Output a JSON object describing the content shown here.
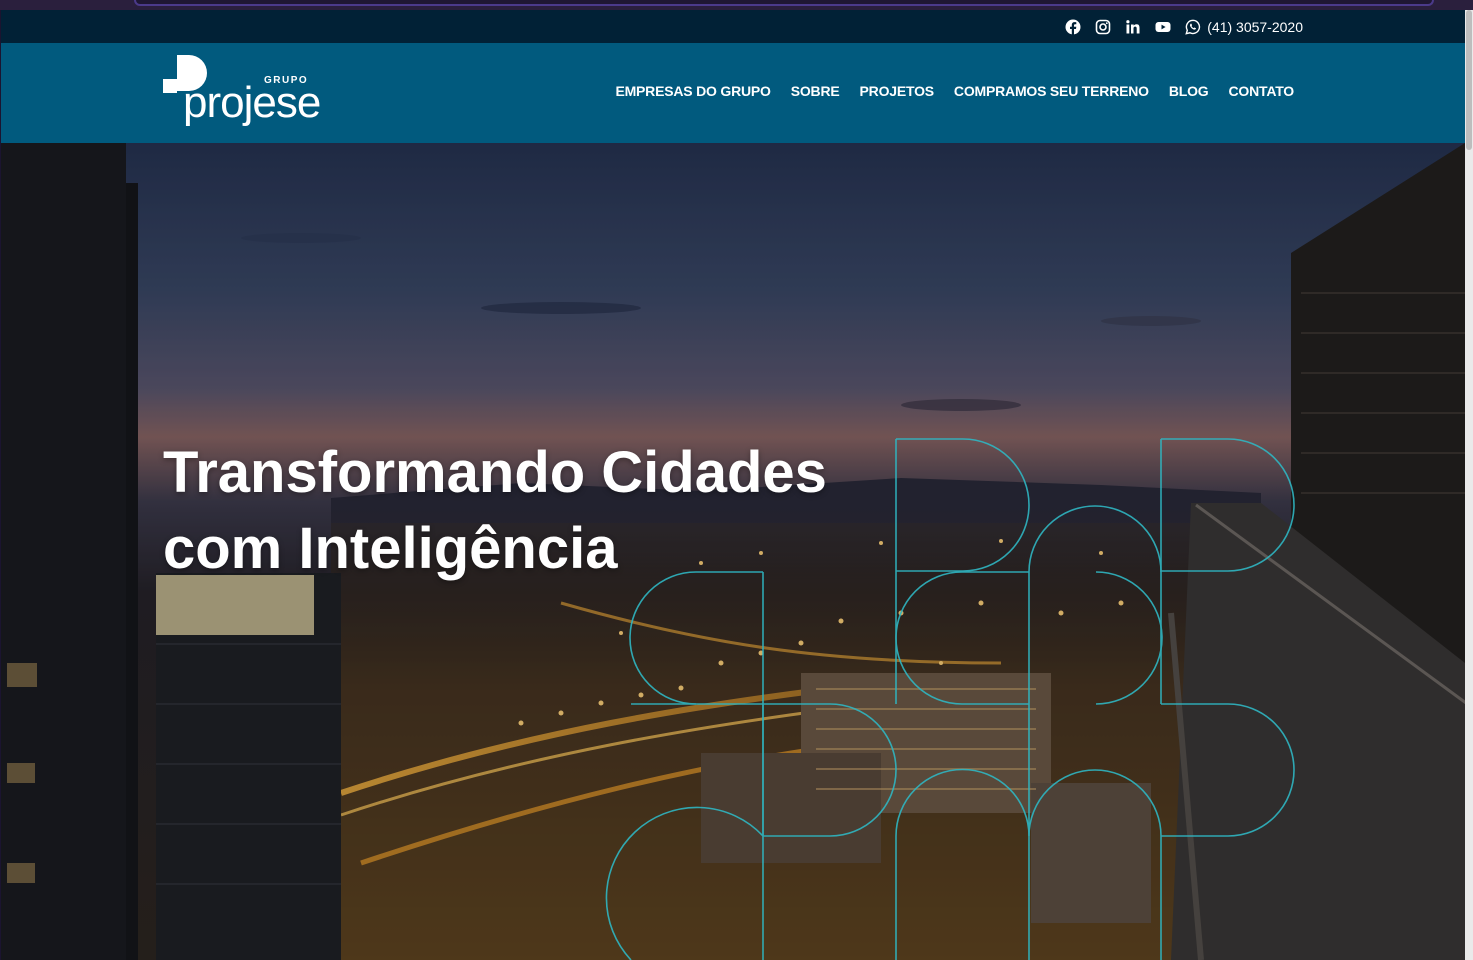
{
  "topbar": {
    "social_icons": [
      "facebook-icon",
      "instagram-icon",
      "linkedin-icon",
      "youtube-icon"
    ],
    "phone": "(41) 3057-2020",
    "phone_icon": "whatsapp-icon"
  },
  "brand": {
    "grupo": "GRUPO",
    "name": "projese"
  },
  "nav": {
    "items": [
      {
        "label": "EMPRESAS DO GRUPO"
      },
      {
        "label": "SOBRE"
      },
      {
        "label": "PROJETOS"
      },
      {
        "label": "COMPRAMOS SEU TERRENO"
      },
      {
        "label": "BLOG"
      },
      {
        "label": "CONTATO"
      }
    ]
  },
  "hero": {
    "title_line1": "Transformando Cidades",
    "title_line2_light": "com",
    "title_line2_strong": "Inteligência"
  },
  "colors": {
    "topbar_bg": "#012136",
    "header_bg": "#015a7e",
    "accent_outline": "#2fb6c2",
    "text": "#ffffff"
  }
}
